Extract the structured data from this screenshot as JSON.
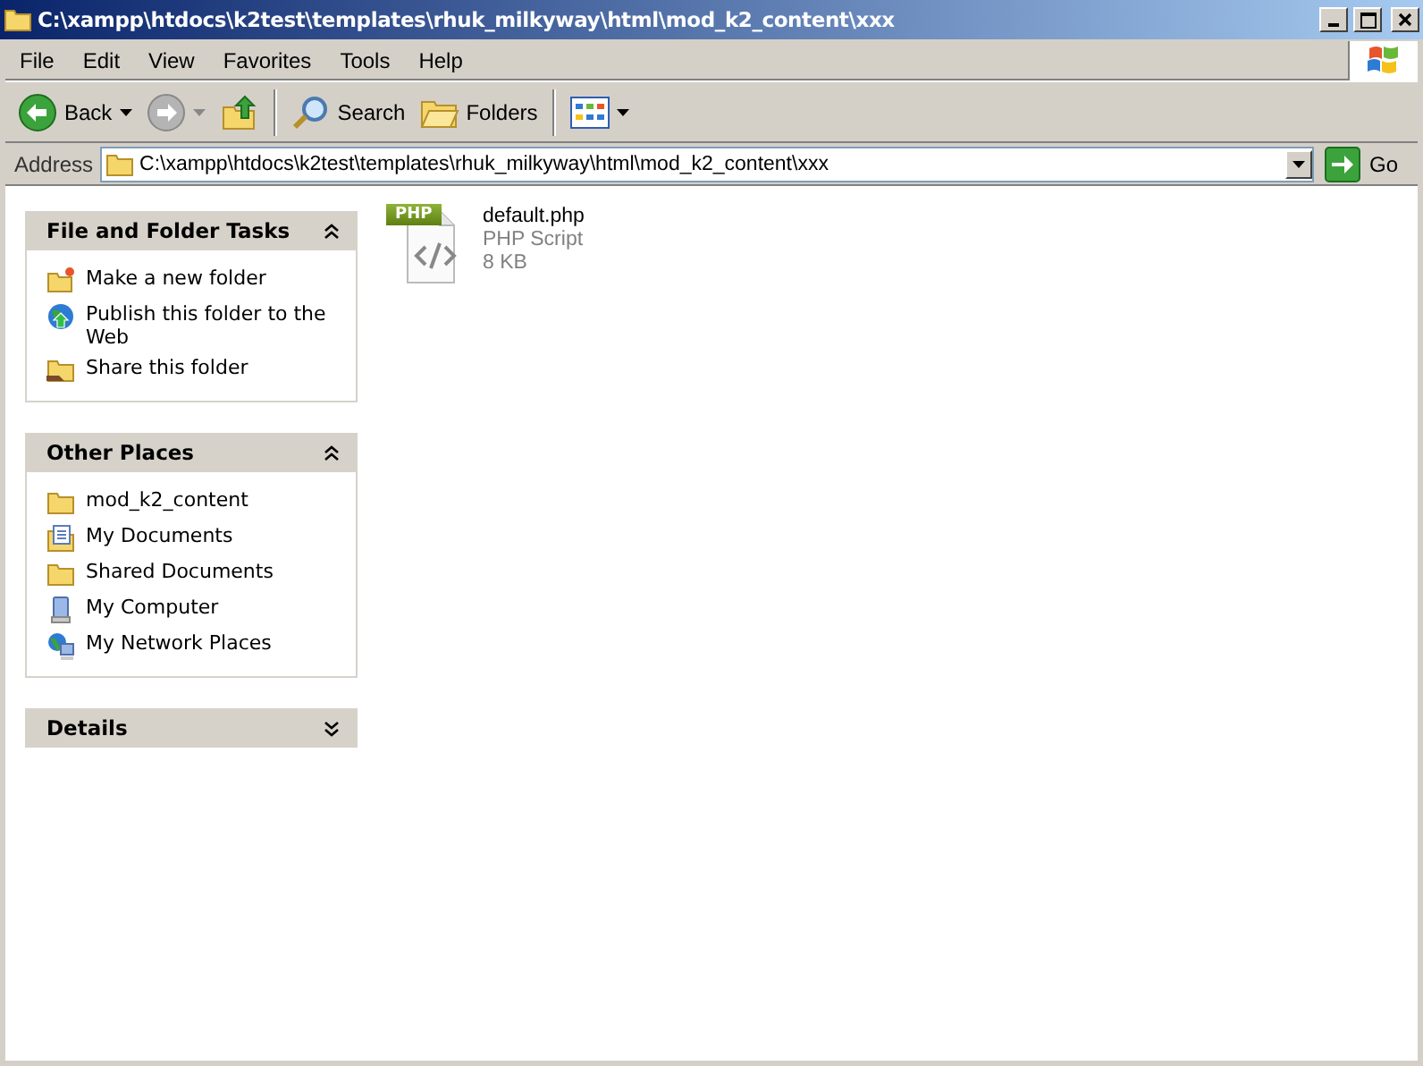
{
  "window": {
    "title": "C:\\xampp\\htdocs\\k2test\\templates\\rhuk_milkyway\\html\\mod_k2_content\\xxx"
  },
  "menu": [
    "File",
    "Edit",
    "View",
    "Favorites",
    "Tools",
    "Help"
  ],
  "toolbar": {
    "back": "Back",
    "search": "Search",
    "folders": "Folders"
  },
  "address": {
    "label": "Address",
    "value": "C:\\xampp\\htdocs\\k2test\\templates\\rhuk_milkyway\\html\\mod_k2_content\\xxx",
    "go": "Go"
  },
  "panels": [
    {
      "title": "File and Folder Tasks",
      "expanded": true,
      "items": [
        {
          "label": "Make a new folder",
          "kind": "new-folder"
        },
        {
          "label": "Publish this folder to the Web",
          "kind": "publish"
        },
        {
          "label": "Share this folder",
          "kind": "share"
        }
      ]
    },
    {
      "title": "Other Places",
      "expanded": true,
      "items": [
        {
          "label": "mod_k2_content",
          "kind": "folder"
        },
        {
          "label": "My Documents",
          "kind": "documents"
        },
        {
          "label": "Shared Documents",
          "kind": "folder"
        },
        {
          "label": "My Computer",
          "kind": "computer"
        },
        {
          "label": "My Network Places",
          "kind": "network"
        }
      ]
    },
    {
      "title": "Details",
      "expanded": false
    }
  ],
  "files": [
    {
      "name": "default.php",
      "type": "PHP Script",
      "size": "8 KB",
      "badge": "PHP"
    }
  ]
}
